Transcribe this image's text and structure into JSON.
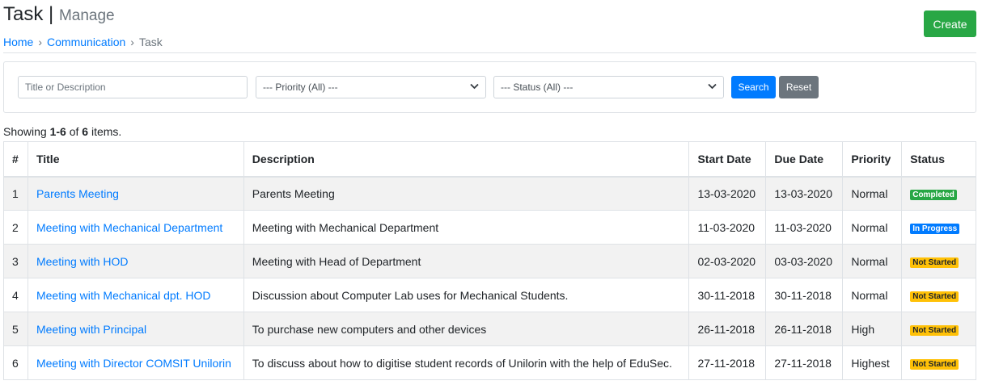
{
  "header": {
    "title": "Task",
    "separator": "|",
    "subtitle": "Manage",
    "breadcrumb": [
      {
        "label": "Home",
        "link": true
      },
      {
        "label": "Communication",
        "link": true
      },
      {
        "label": "Task",
        "link": false
      }
    ],
    "breadcrumb_separator": "›"
  },
  "actions": {
    "create_label": "Create"
  },
  "search": {
    "title_placeholder": "Title or Description",
    "priority_value": "--- Priority (All) ---",
    "status_value": "--- Status (All) ---",
    "search_label": "Search",
    "reset_label": "Reset"
  },
  "summary": {
    "prefix": "Showing ",
    "range": "1-6",
    "of": " of ",
    "total": "6",
    "suffix": " items."
  },
  "table": {
    "columns": [
      "#",
      "Title",
      "Description",
      "Start Date",
      "Due Date",
      "Priority",
      "Status"
    ],
    "rows": [
      {
        "n": "1",
        "title": "Parents Meeting",
        "description": "Parents Meeting",
        "start": "13-03-2020",
        "due": "13-03-2020",
        "priority": "Normal",
        "status": "Completed",
        "status_color": "#28a745"
      },
      {
        "n": "2",
        "title": "Meeting with Mechanical Department",
        "description": "Meeting with Mechanical Department",
        "start": "11-03-2020",
        "due": "11-03-2020",
        "priority": "Normal",
        "status": "In Progress",
        "status_color": "#007bff"
      },
      {
        "n": "3",
        "title": "Meeting with HOD",
        "description": "Meeting with Head of Department",
        "start": "02-03-2020",
        "due": "03-03-2020",
        "priority": "Normal",
        "status": "Not Started",
        "status_color": "#ffc107"
      },
      {
        "n": "4",
        "title": "Meeting with Mechanical dpt. HOD",
        "description": "Discussion about Computer Lab uses for Mechanical Students.",
        "start": "30-11-2018",
        "due": "30-11-2018",
        "priority": "Normal",
        "status": "Not Started",
        "status_color": "#ffc107"
      },
      {
        "n": "5",
        "title": "Meeting with Principal",
        "description": "To purchase new computers and other devices",
        "start": "26-11-2018",
        "due": "26-11-2018",
        "priority": "High",
        "status": "Not Started",
        "status_color": "#ffc107"
      },
      {
        "n": "6",
        "title": "Meeting with Director COMSIT Unilorin",
        "description": "To discuss about how to digitise student records of Unilorin with the help of EduSec.",
        "start": "27-11-2018",
        "due": "27-11-2018",
        "priority": "Highest",
        "status": "Not Started",
        "status_color": "#ffc107"
      }
    ]
  }
}
